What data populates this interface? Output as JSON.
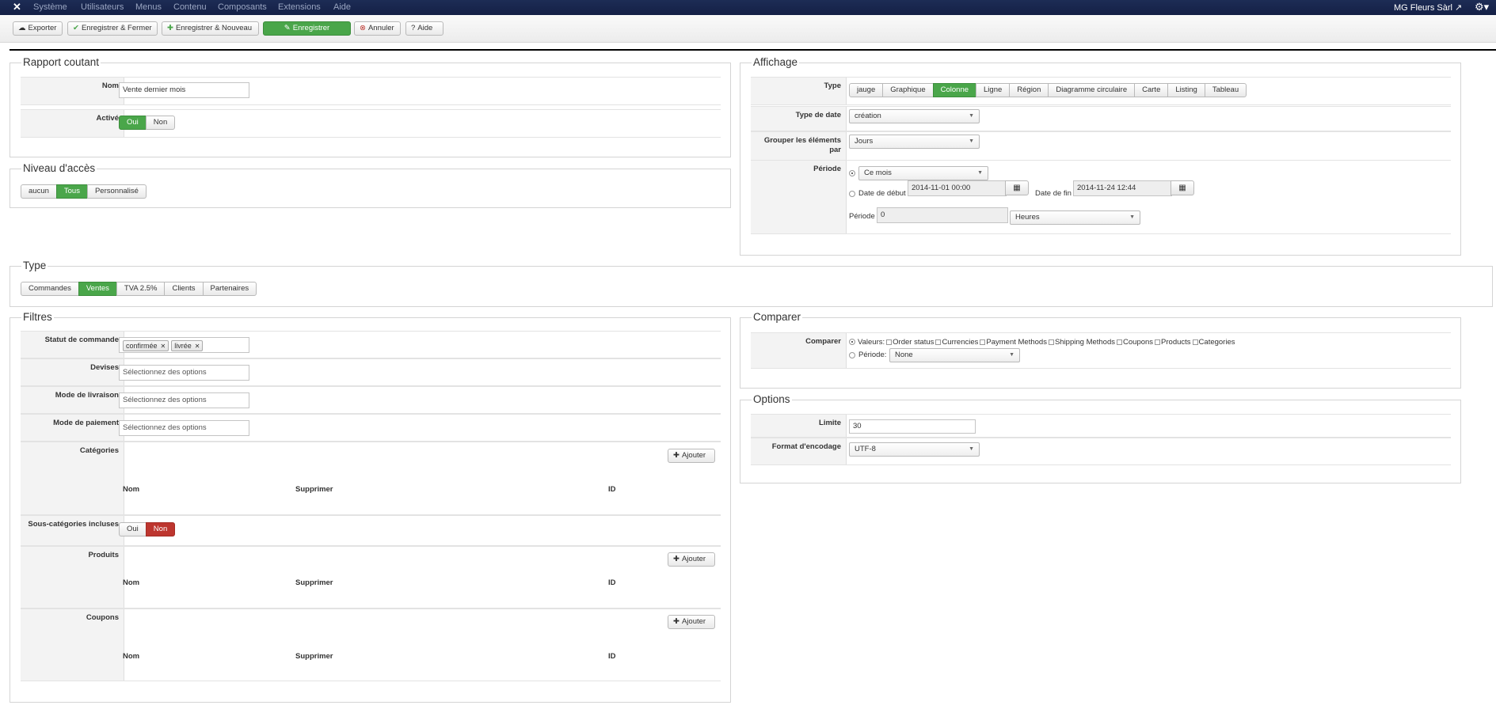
{
  "topnav": {
    "menu": [
      "Système",
      "Utilisateurs",
      "Menus",
      "Contenu",
      "Composants",
      "Extensions",
      "Aide"
    ],
    "site_name": "MG Fleurs Sàrl"
  },
  "toolbar": {
    "export": "Exporter",
    "save_close": "Enregistrer & Fermer",
    "save_new": "Enregistrer & Nouveau",
    "save": "Enregistrer",
    "cancel": "Annuler",
    "help": "Aide"
  },
  "report": {
    "legend": "Rapport coutant",
    "name_label": "Nom",
    "name_value": "Vente dernier mois",
    "active_label": "Activé",
    "active_yes": "Oui",
    "active_no": "Non"
  },
  "access": {
    "legend": "Niveau d'accès",
    "options": [
      "aucun",
      "Tous",
      "Personnalisé"
    ]
  },
  "display": {
    "legend": "Affichage",
    "type_label": "Type",
    "types": [
      "jauge",
      "Graphique",
      "Colonne",
      "Ligne",
      "Région",
      "Diagramme circulaire",
      "Carte",
      "Listing",
      "Tableau"
    ],
    "date_type_label": "Type de date",
    "date_type_value": "création",
    "group_label": "Grouper les éléments par",
    "group_value": "Jours",
    "period_label": "Période",
    "period_select": "Ce mois",
    "start_label": "Date de début",
    "start_value": "2014-11-01 00:00",
    "end_label": "Date de fin",
    "end_value": "2014-11-24 12:44",
    "period_text": "Période",
    "period_number": "0",
    "period_unit": "Heures"
  },
  "type_section": {
    "legend": "Type",
    "options": [
      "Commandes",
      "Ventes",
      "TVA 2.5%",
      "Clients",
      "Partenaires"
    ]
  },
  "filters": {
    "legend": "Filtres",
    "order_status_label": "Statut de commande",
    "order_status_tags": [
      "confirmée",
      "livrée"
    ],
    "currencies_label": "Devises",
    "shipping_label": "Mode de livraison",
    "payment_label": "Mode de paiement",
    "placeholder": "Sélectionnez des options",
    "categories_label": "Catégories",
    "add_label": "Ajouter",
    "col_name": "Nom",
    "col_delete": "Supprimer",
    "col_id": "ID",
    "subcat_label": "Sous-catégories incluses",
    "subcat_yes": "Oui",
    "subcat_no": "Non",
    "products_label": "Produits",
    "coupons_label": "Coupons"
  },
  "compare": {
    "legend": "Comparer",
    "label": "Comparer",
    "values_label": "Valeurs:",
    "checks": [
      "Order status",
      "Currencies",
      "Payment Methods",
      "Shipping Methods",
      "Coupons",
      "Products",
      "Categories"
    ],
    "period_label": "Période:",
    "period_value": "None"
  },
  "options": {
    "legend": "Options",
    "limit_label": "Limite",
    "limit_value": "30",
    "encoding_label": "Format d'encodage",
    "encoding_value": "UTF-8"
  }
}
